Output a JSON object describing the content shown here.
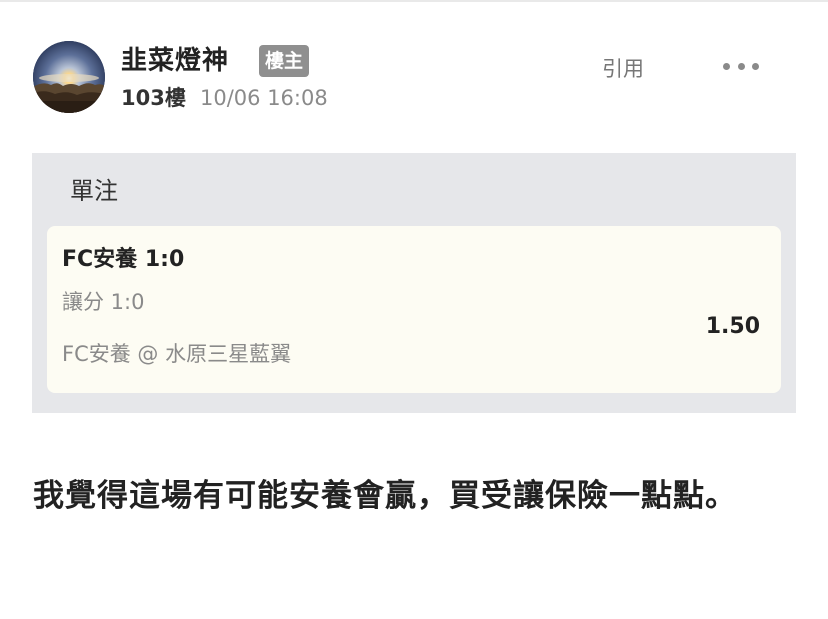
{
  "post": {
    "author_name": "韭菜燈神",
    "op_badge": "樓主",
    "floor": "103樓",
    "timestamp": "10/06 16:08",
    "quote_label": "引用",
    "more_icon": "more-horizontal-icon",
    "avatar_icon": "sunrise-landscape-avatar"
  },
  "bet": {
    "type_label": "單注",
    "selection": "FC安養 1:0",
    "market": "讓分 1:0",
    "match": "FC安養 @ 水原三星藍翼",
    "odds": "1.50"
  },
  "body": {
    "text": "我覺得這場有可能安養會贏，買受讓保險一點點。"
  },
  "colors": {
    "badge_bg": "#8f8f8f",
    "card_bg": "#e6e7ea",
    "slip_bg": "#fdfcf3",
    "muted_text": "#8a8a8a"
  }
}
